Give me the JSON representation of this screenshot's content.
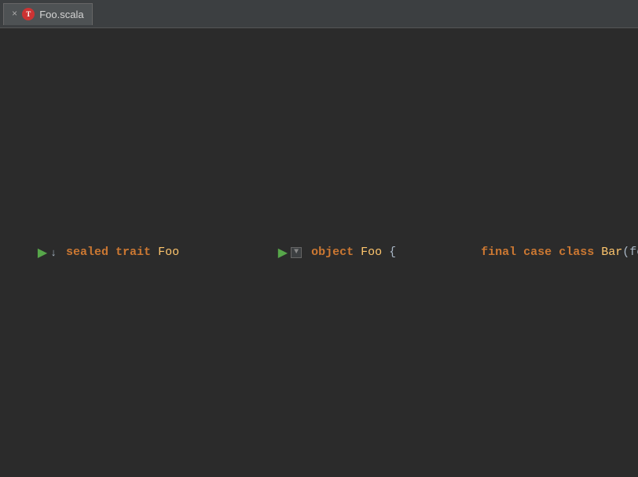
{
  "tab": {
    "close_label": "×",
    "icon_label": "T",
    "title": "Foo.scala"
  },
  "colors": {
    "background": "#2b2b2b",
    "tab_bg": "#4e5254",
    "highlighted_line": "#fffde7",
    "keyword": "#cc7832",
    "type_color": "#ffc66d",
    "plain": "#a9b7c6",
    "run_icon": "#57a64a"
  },
  "lines": [
    {
      "id": 1,
      "has_run": false,
      "has_fold": false,
      "has_run_top": true,
      "indent": 0,
      "highlighted": false
    },
    {
      "id": 2,
      "has_run": false,
      "has_fold": false,
      "indent": 0,
      "highlighted": false
    },
    {
      "id": 3,
      "has_run": true,
      "has_fold": true,
      "indent": 0,
      "highlighted": false
    },
    {
      "id": 4,
      "indent": 1,
      "highlighted": false
    },
    {
      "id": 5,
      "indent": 1,
      "highlighted": false
    },
    {
      "id": 6,
      "indent": 0,
      "highlighted": false
    },
    {
      "id": 7,
      "has_run": true,
      "has_fold": true,
      "indent": 1,
      "highlighted": false
    },
    {
      "id": 8,
      "indent": 2,
      "highlighted": false
    },
    {
      "id": 9,
      "indent": 2,
      "highlighted": true
    },
    {
      "id": 10,
      "indent": 3,
      "highlighted": true,
      "has_cursor": true
    },
    {
      "id": 11,
      "indent": 3,
      "highlighted": false
    },
    {
      "id": 12,
      "indent": 3,
      "highlighted": false
    },
    {
      "id": 13,
      "indent": 2,
      "highlighted": false
    },
    {
      "id": 14,
      "indent": 1,
      "highlighted": false
    },
    {
      "id": 15,
      "indent": 0,
      "highlighted": false
    }
  ]
}
